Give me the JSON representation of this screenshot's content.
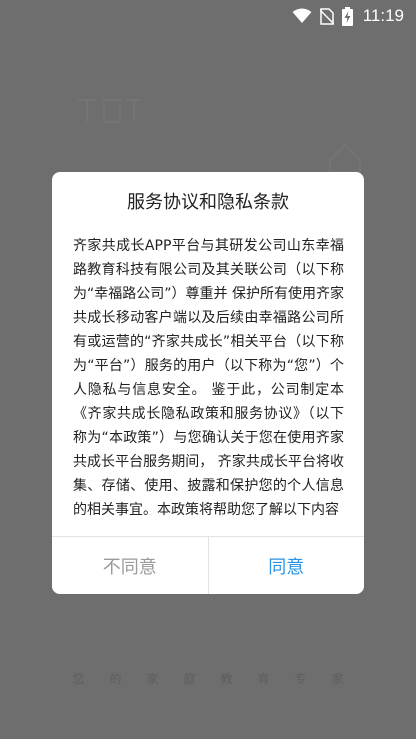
{
  "status_bar": {
    "time": "11:19",
    "icons": [
      "wifi-icon",
      "no-sim-icon",
      "battery-charging-icon"
    ]
  },
  "background": {
    "tagline": "您的家庭教育专家"
  },
  "dialog": {
    "title": "服务协议和隐私条款",
    "body": "齐家共成长APP平台与其研发公司山东幸福路教育科技有限公司及其关联公司（以下称为“幸福路公司”）尊重并 保护所有使用齐家共成长移动客户端以及后续由幸福路公司所有或运营的“齐家共成长”相关平台（以下称为“平台”）服务的用户（以下称为“您”）个人隐私与信息安全。 鉴于此，公司制定本《齐家共成长隐私政策和服务协议》（以下称为“本政策”）与您确认关于您在使用齐家共成长平台服务期间， 齐家共成长平台将收集、存储、使用、披露和保护您的个人信息的相关事宜。本政策将帮助您了解以下内容",
    "disagree_label": "不同意",
    "agree_label": "同意"
  },
  "colors": {
    "overlay": "#6e6e6e",
    "agree": "#2a93e6",
    "disagree": "#9a9a9a"
  }
}
